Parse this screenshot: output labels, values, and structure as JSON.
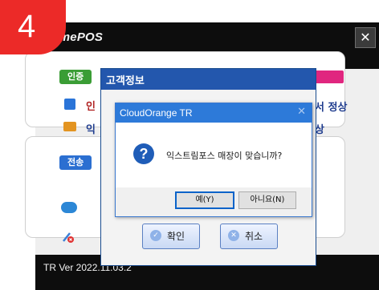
{
  "badge": {
    "step": "4"
  },
  "app": {
    "title": "tremePOS",
    "close_glyph": "✕",
    "version": "TR Ver 2022.11.03.2",
    "sections": {
      "auth_tab": "인증",
      "transfer_tab": "전송",
      "row1_left": "인",
      "row2_left": "익",
      "row1_right": "서 정상",
      "row2_right": "상"
    }
  },
  "customer_dialog": {
    "title": "고객정보",
    "ok_label": "확인",
    "cancel_label": "취소"
  },
  "message_box": {
    "title": "CloudOrange TR",
    "close_glyph": "✕",
    "icon": "question-icon",
    "message": "익스트림포스 매장이 맞습니까?",
    "yes_label": "예(Y)",
    "no_label": "아니요(N)"
  },
  "colors": {
    "title_bar": "#2357ad",
    "msg_title_bar": "#2d7ad9",
    "badge": "#ec2a28",
    "auth_tab": "#3a9d35",
    "transfer_tab": "#2b6fd1"
  }
}
